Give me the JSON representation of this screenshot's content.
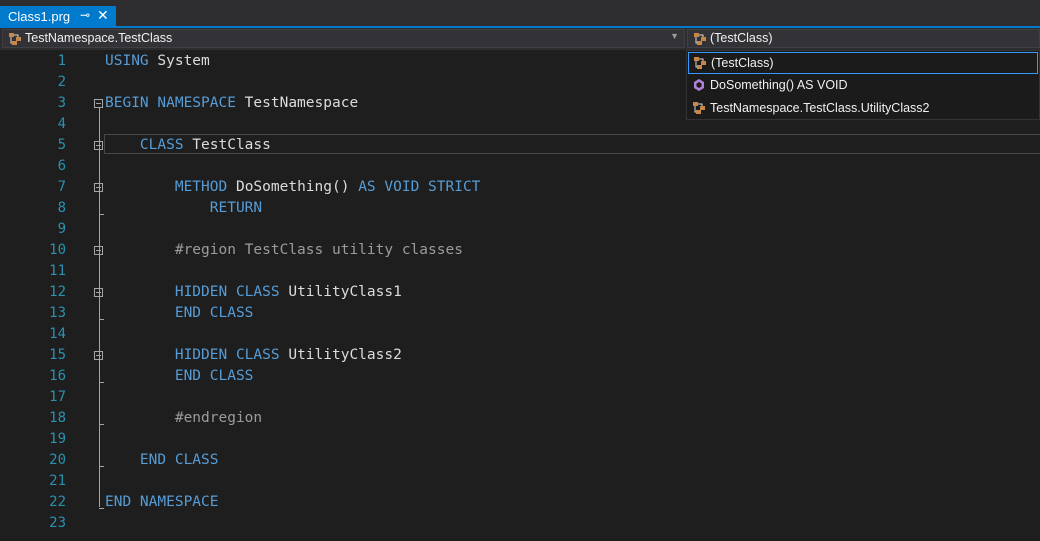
{
  "tab": {
    "title": "Class1.prg",
    "pin_glyph": "⊸",
    "close_glyph": "✕"
  },
  "navbar": {
    "left": {
      "text": "TestNamespace.TestClass",
      "icon": "class-icon"
    },
    "right": {
      "text": "(TestClass)",
      "icon": "class-icon"
    }
  },
  "dropdown": {
    "items": [
      {
        "text": "(TestClass)",
        "icon": "class-icon",
        "selected": true
      },
      {
        "text": "DoSomething() AS VOID",
        "icon": "method-icon",
        "selected": false
      },
      {
        "text": "TestNamespace.TestClass.UtilityClass2",
        "icon": "class-icon",
        "selected": false
      }
    ]
  },
  "editor": {
    "lines": [
      {
        "n": "1",
        "tokens": [
          {
            "k": "kw",
            "t": "USING"
          },
          {
            "k": "tx",
            "t": " System"
          }
        ]
      },
      {
        "n": "2",
        "tokens": []
      },
      {
        "n": "3",
        "tokens": [
          {
            "k": "kw",
            "t": "BEGIN NAMESPACE"
          },
          {
            "k": "tx",
            "t": " TestNamespace"
          }
        ]
      },
      {
        "n": "4",
        "tokens": []
      },
      {
        "n": "5",
        "tokens": [
          {
            "k": "tx",
            "t": "    "
          },
          {
            "k": "kw",
            "t": "CLASS"
          },
          {
            "k": "tx",
            "t": " TestClass"
          }
        ]
      },
      {
        "n": "6",
        "tokens": []
      },
      {
        "n": "7",
        "tokens": [
          {
            "k": "tx",
            "t": "        "
          },
          {
            "k": "kw",
            "t": "METHOD"
          },
          {
            "k": "tx",
            "t": " DoSomething() "
          },
          {
            "k": "kw",
            "t": "AS VOID STRICT"
          }
        ]
      },
      {
        "n": "8",
        "tokens": [
          {
            "k": "tx",
            "t": "            "
          },
          {
            "k": "kw",
            "t": "RETURN"
          }
        ]
      },
      {
        "n": "9",
        "tokens": []
      },
      {
        "n": "10",
        "tokens": [
          {
            "k": "tx",
            "t": "        "
          },
          {
            "k": "rg",
            "t": "#region TestClass utility classes"
          }
        ]
      },
      {
        "n": "11",
        "tokens": []
      },
      {
        "n": "12",
        "tokens": [
          {
            "k": "tx",
            "t": "        "
          },
          {
            "k": "kw",
            "t": "HIDDEN CLASS"
          },
          {
            "k": "tx",
            "t": " UtilityClass1"
          }
        ]
      },
      {
        "n": "13",
        "tokens": [
          {
            "k": "tx",
            "t": "        "
          },
          {
            "k": "kw",
            "t": "END CLASS"
          }
        ]
      },
      {
        "n": "14",
        "tokens": []
      },
      {
        "n": "15",
        "tokens": [
          {
            "k": "tx",
            "t": "        "
          },
          {
            "k": "kw",
            "t": "HIDDEN CLASS"
          },
          {
            "k": "tx",
            "t": " UtilityClass2"
          }
        ]
      },
      {
        "n": "16",
        "tokens": [
          {
            "k": "tx",
            "t": "        "
          },
          {
            "k": "kw",
            "t": "END CLASS"
          }
        ]
      },
      {
        "n": "17",
        "tokens": []
      },
      {
        "n": "18",
        "tokens": [
          {
            "k": "tx",
            "t": "        "
          },
          {
            "k": "rg",
            "t": "#endregion"
          }
        ]
      },
      {
        "n": "19",
        "tokens": []
      },
      {
        "n": "20",
        "tokens": [
          {
            "k": "tx",
            "t": "    "
          },
          {
            "k": "kw",
            "t": "END CLASS"
          }
        ]
      },
      {
        "n": "21",
        "tokens": []
      },
      {
        "n": "22",
        "tokens": [
          {
            "k": "kw",
            "t": "END NAMESPACE"
          }
        ]
      },
      {
        "n": "23",
        "tokens": []
      }
    ],
    "fold_lines": [
      "3",
      "5",
      "7",
      "10",
      "12",
      "15"
    ],
    "current_line": "5"
  },
  "colors": {
    "accent": "#007acc",
    "keyword": "#569cd6",
    "line_number": "#2b91af",
    "region": "#9b9b9b",
    "text": "#dcdcdc",
    "background": "#1e1e1e"
  }
}
